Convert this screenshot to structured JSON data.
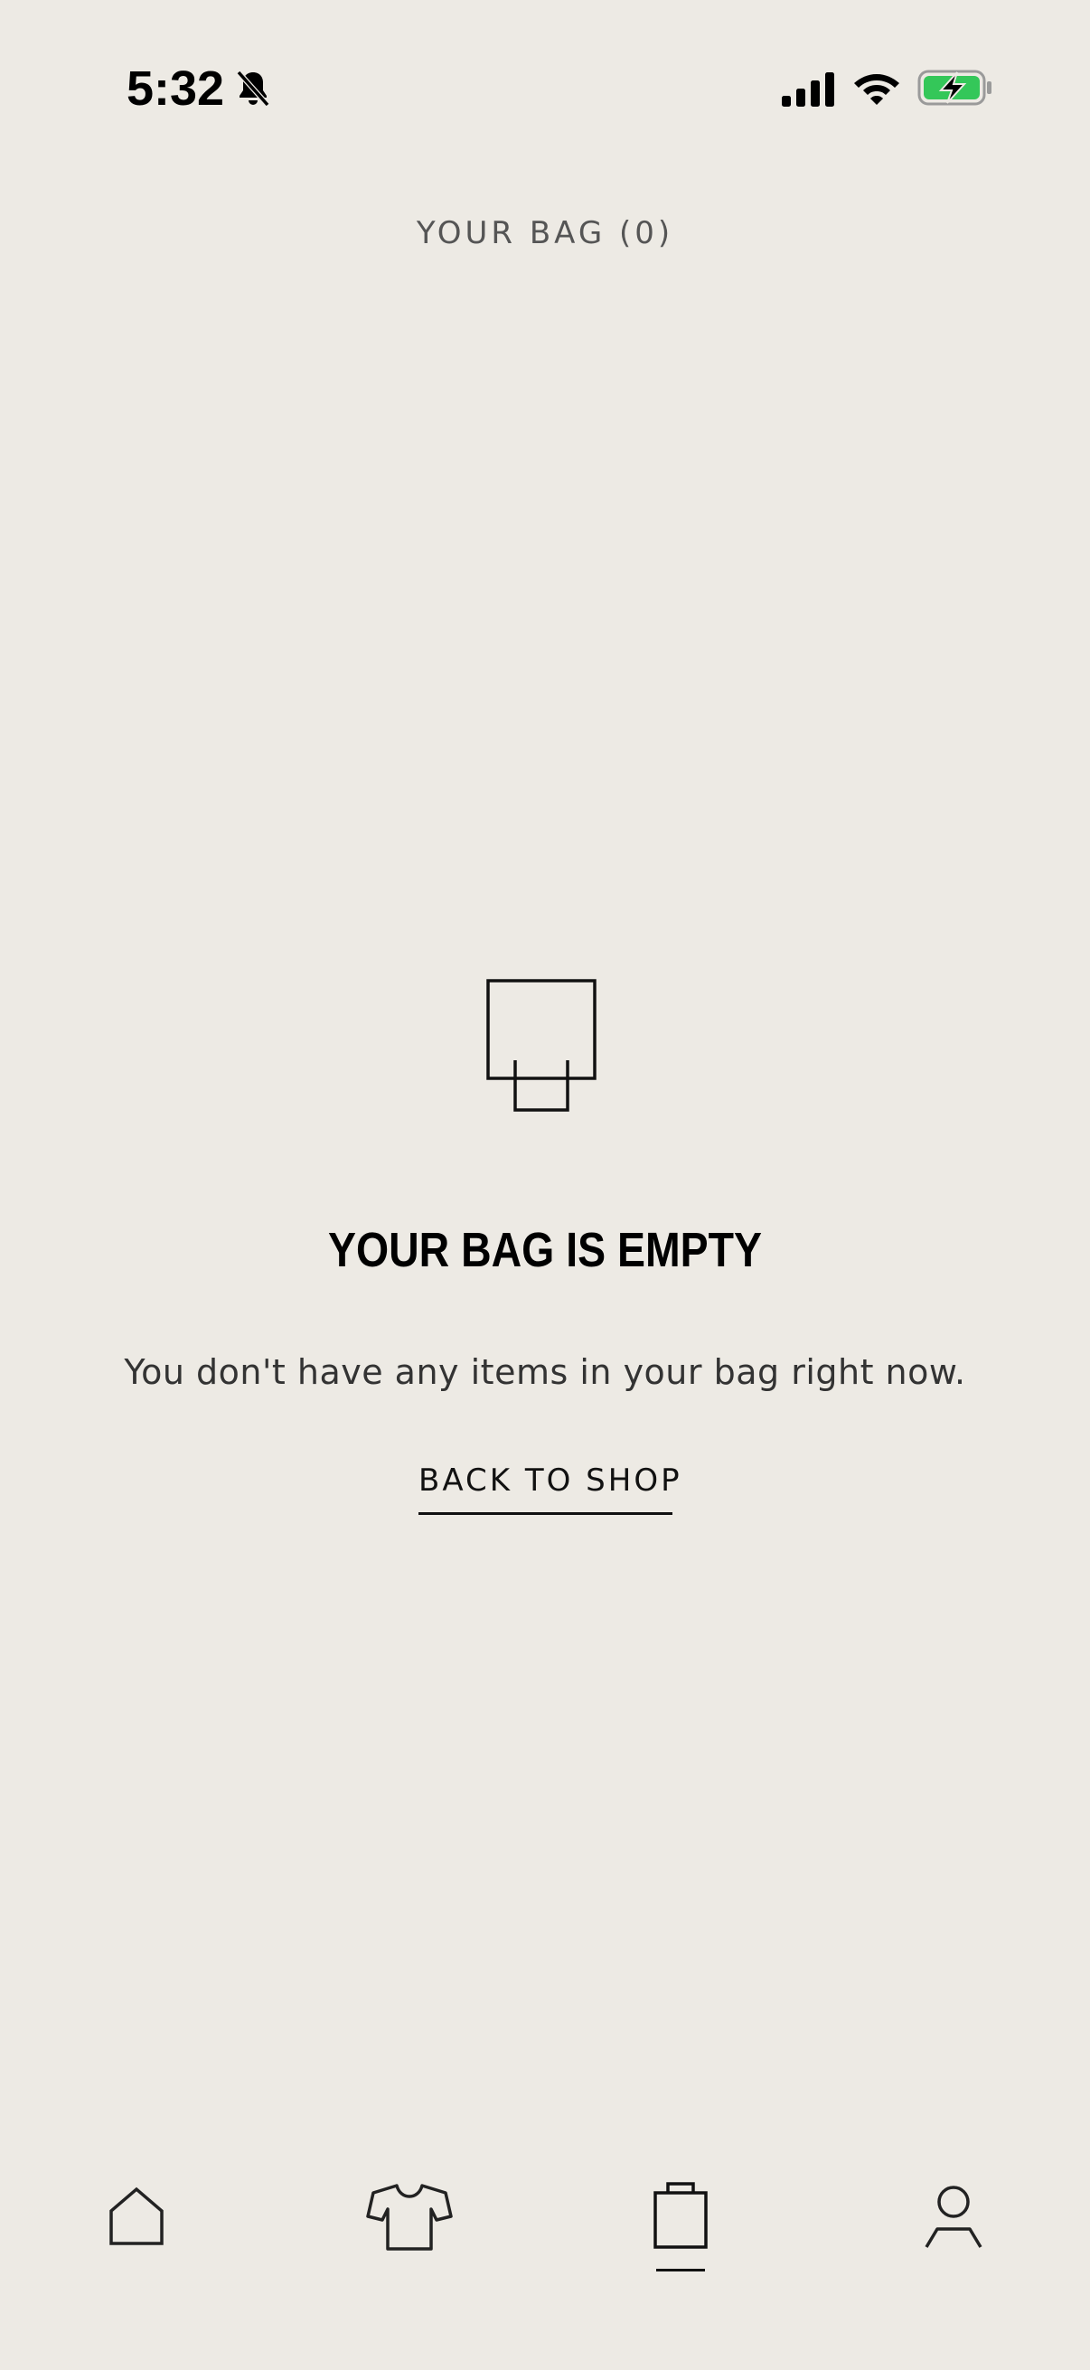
{
  "status_bar": {
    "time": "5:32",
    "icons": [
      "bell-slash-icon",
      "cellular-signal-icon",
      "wifi-icon",
      "battery-charging-icon"
    ],
    "battery_color": "#34C759"
  },
  "header": {
    "title": "YOUR BAG (0)"
  },
  "empty_state": {
    "illustration": "shopping-bag-icon",
    "title": "YOUR BAG IS EMPTY",
    "message": "You don't have any items in your bag right now.",
    "cta_label": "BACK TO SHOP"
  },
  "bottom_nav": {
    "items": [
      {
        "icon": "home-icon",
        "active": false
      },
      {
        "icon": "tshirt-icon",
        "active": false
      },
      {
        "icon": "shopping-bag-icon",
        "active": true
      },
      {
        "icon": "user-icon",
        "active": false
      }
    ]
  },
  "colors": {
    "background": "#EDEAE4",
    "text": "#111111",
    "muted_text": "#555555"
  }
}
